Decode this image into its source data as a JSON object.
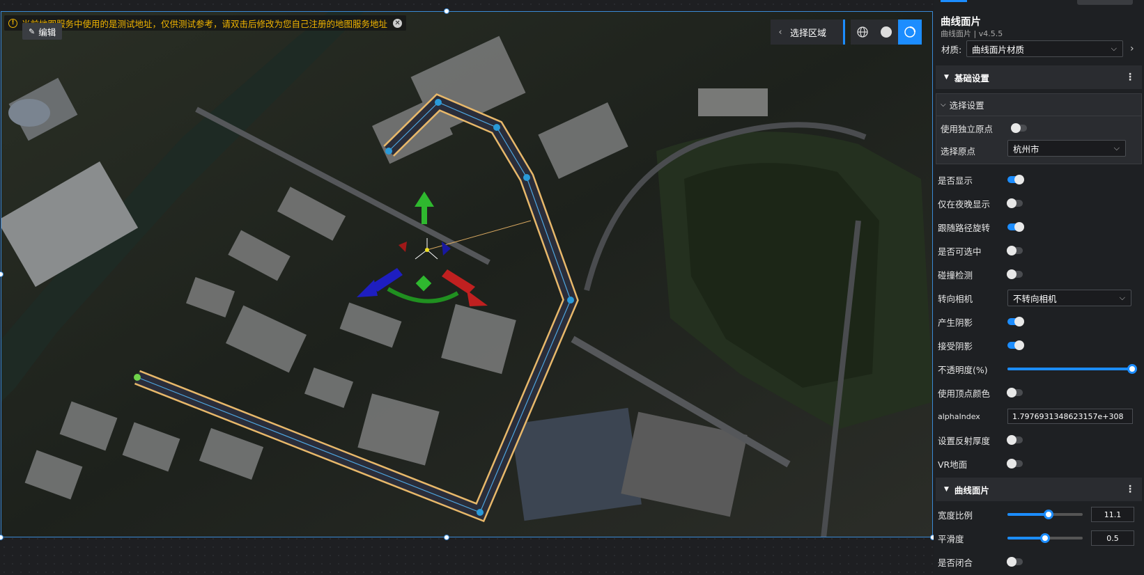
{
  "warning": "当前地图服务中使用的是测试地址，仅供测试参考，请双击后修改为您自己注册的地图服务地址",
  "edit_label": "编辑",
  "region_select_label": "选择区域",
  "panel": {
    "title": "曲线面片",
    "version": "曲线面片 | v4.5.5",
    "material_label": "材质:",
    "material_value": "曲线面片材质",
    "basic_section": "基础设置",
    "select_settings": "选择设置",
    "independent_origin": "使用独立原点",
    "select_origin": "选择原点",
    "origin_value": "杭州市",
    "visible": "是否显示",
    "night_only": "仅在夜晚显示",
    "follow_path": "跟随路径旋转",
    "selectable": "是否可选中",
    "collision": "碰撞检测",
    "face_camera": "转向相机",
    "face_camera_value": "不转向相机",
    "cast_shadow": "产生阴影",
    "receive_shadow": "接受阴影",
    "opacity": "不透明度(%)",
    "opacity_value": 1.0,
    "vertex_color": "使用顶点颜色",
    "alpha_index": "alphaIndex",
    "alpha_index_value": "1.7976931348623157e+308",
    "reflect_thickness": "设置反射厚度",
    "vr_ground": "VR地面",
    "curve_section": "曲线面片",
    "width_ratio": "宽度比例",
    "width_ratio_value": "11.1",
    "width_ratio_fraction": 0.55,
    "smoothness": "平滑度",
    "smoothness_value": "0.5",
    "smoothness_fraction": 0.5,
    "closed": "是否闭合"
  },
  "colors": {
    "accent": "#1c8dff",
    "warning": "#f0b400",
    "path_outline": "#e8b86a"
  }
}
